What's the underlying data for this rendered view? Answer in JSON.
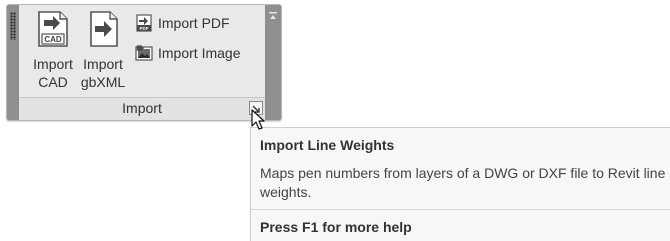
{
  "panel": {
    "title": "Import",
    "buttons_large": [
      {
        "label": "Import\nCAD",
        "icon": "import-cad-icon"
      },
      {
        "label": "Import\ngbXML",
        "icon": "import-gbxml-icon"
      }
    ],
    "buttons_small": [
      {
        "label": "Import  PDF",
        "icon": "import-pdf-icon"
      },
      {
        "label": "Import  Image",
        "icon": "import-image-icon"
      }
    ],
    "icon_text": {
      "cad": "CAD",
      "pdf": "PDF"
    },
    "launcher_icon": "dialog-launcher-icon",
    "collapse_icon": "collapse-icon"
  },
  "tooltip": {
    "title": "Import Line Weights",
    "description": "Maps pen numbers from layers of a DWG or DXF file to Revit line weights.",
    "help": "Press F1 for more help"
  },
  "cursor": {
    "icon": "mouse-pointer-icon"
  },
  "colors": {
    "panel_bg": "#e9e9e9",
    "grip": "#8f8f8f",
    "icon_blue": "#3d6e9e",
    "text": "#333333"
  }
}
